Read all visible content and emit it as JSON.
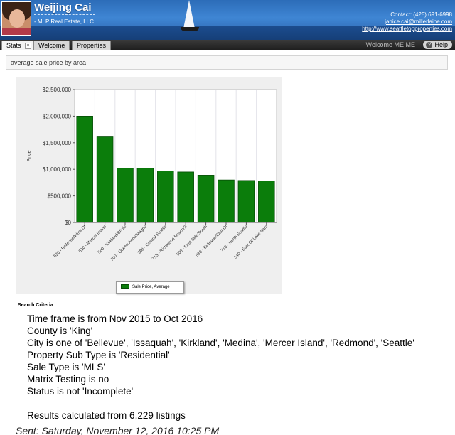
{
  "header": {
    "agent_name": "Weijing Cai",
    "company": "- MLP Real Estate, LLC",
    "contact_label": "Contact: (425) 691-6998",
    "email": "janice.cai@millerlaine.com",
    "website": "http://www.seattletopproperties.com"
  },
  "tabs": [
    {
      "label": "Stats",
      "active": true,
      "closable": true
    },
    {
      "label": "Welcome",
      "active": false
    },
    {
      "label": "Properties",
      "active": false
    }
  ],
  "tabbar": {
    "welcome_text": "Welcome ME ME",
    "help_label": "Help",
    "help_icon": "question-icon"
  },
  "section": {
    "title": "average sale price by area"
  },
  "chart_data": {
    "type": "bar",
    "title": "",
    "xlabel": "",
    "ylabel": "Price",
    "ylim": [
      0,
      2500000
    ],
    "y_ticks": [
      "$0",
      "$500,000",
      "$1,000,000",
      "$1,500,000",
      "$2,000,000",
      "$2,500,000"
    ],
    "grid": true,
    "legend_placement": "bottom",
    "bar_color": "#0b7d0b",
    "categories": [
      "520 - Bellevue/West Of",
      "510 - Mercer Island",
      "560 - Kirkland/Bridle",
      "700 - Queen Anne/Magno",
      "380 - Central Seattle",
      "715 - Richmond Beach/S",
      "500 - East Side/South",
      "530 - Bellevue/East Of",
      "710 - North Seattle",
      "540 - East Of Lake Sam"
    ],
    "series": [
      {
        "name": "Sale Price, Average",
        "values": [
          2000000,
          1610000,
          1020000,
          1020000,
          970000,
          950000,
          890000,
          800000,
          790000,
          780000
        ]
      }
    ]
  },
  "criteria": {
    "heading": "Search Criteria",
    "lines": [
      "Time frame is from Nov 2015 to Oct 2016",
      "County is 'King'",
      "City is one of 'Bellevue', 'Issaquah', 'Kirkland', 'Medina', 'Mercer Island', 'Redmond', 'Seattle'",
      "Property Sub Type is 'Residential'",
      "Sale Type is 'MLS'",
      "Matrix Testing is no",
      "Status is not 'Incomplete'"
    ],
    "results": "Results calculated from 6,229 listings"
  },
  "footer": {
    "sent": "Sent: Saturday, November 12, 2016 10:25 PM"
  }
}
